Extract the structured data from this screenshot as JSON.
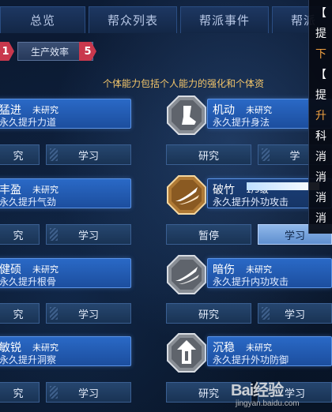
{
  "tabs": [
    {
      "label": "总览"
    },
    {
      "label": "帮众列表"
    },
    {
      "label": "帮派事件"
    },
    {
      "label": "帮派"
    }
  ],
  "subheader": {
    "badge_left": "1",
    "section_label": "生产效率",
    "section_badge": "5"
  },
  "notice": "个体能力包括个人能力的强化和个体资",
  "skills": [
    {
      "name": "猛进",
      "status": "未研究",
      "desc": "永久提升力道",
      "btn_research": "究",
      "btn_learn": "学习"
    },
    {
      "name": "丰盈",
      "status": "未研究",
      "desc": "永久提升气劲",
      "btn_research": "究",
      "btn_learn": "学习"
    },
    {
      "name": "健硕",
      "status": "未研究",
      "desc": "永久提升根骨",
      "btn_research": "究",
      "btn_learn": "学习"
    },
    {
      "name": "敏锐",
      "status": "未研究",
      "desc": "永久提升洞察",
      "btn_research": "究",
      "btn_learn": "学习"
    },
    {
      "name": "机动",
      "status": "未研究",
      "desc": "永久提升身法",
      "btn_research": "研究",
      "btn_learn": "学",
      "icon": "boot-icon"
    },
    {
      "name": "破竹",
      "status": "1/9级",
      "desc": "永久提升外功攻击",
      "btn_research": "暂停",
      "btn_learn": "学习",
      "icon": "slash-icon",
      "progress": 0.85
    },
    {
      "name": "暗伤",
      "status": "未研究",
      "desc": "永久提升内功攻击",
      "btn_research": "研究",
      "btn_learn": "学习",
      "icon": "slash-icon"
    },
    {
      "name": "沉稳",
      "status": "未研究",
      "desc": "永久提升外功防御",
      "btn_research": "研究",
      "btn_learn": "学习",
      "icon": "shield-arrow-icon"
    }
  ],
  "tooltip": {
    "lines": [
      {
        "text": "【",
        "color": "#ffffff"
      },
      {
        "text": "提",
        "color": "#ffffff"
      },
      {
        "text": "下",
        "color": "#f0a040"
      },
      {
        "text": "【",
        "color": "#ffffff"
      },
      {
        "text": "提",
        "color": "#ffffff"
      },
      {
        "text": "升",
        "color": "#f0a040"
      },
      {
        "text": "科",
        "color": "#ffffff"
      },
      {
        "text": "消",
        "color": "#ffffff"
      },
      {
        "text": "消",
        "color": "#ffffff"
      },
      {
        "text": "消",
        "color": "#ffffff"
      },
      {
        "text": "消",
        "color": "#ffffff"
      }
    ]
  },
  "watermark": {
    "brand": "Bai经验",
    "url": "jingyan.baidu.com"
  }
}
